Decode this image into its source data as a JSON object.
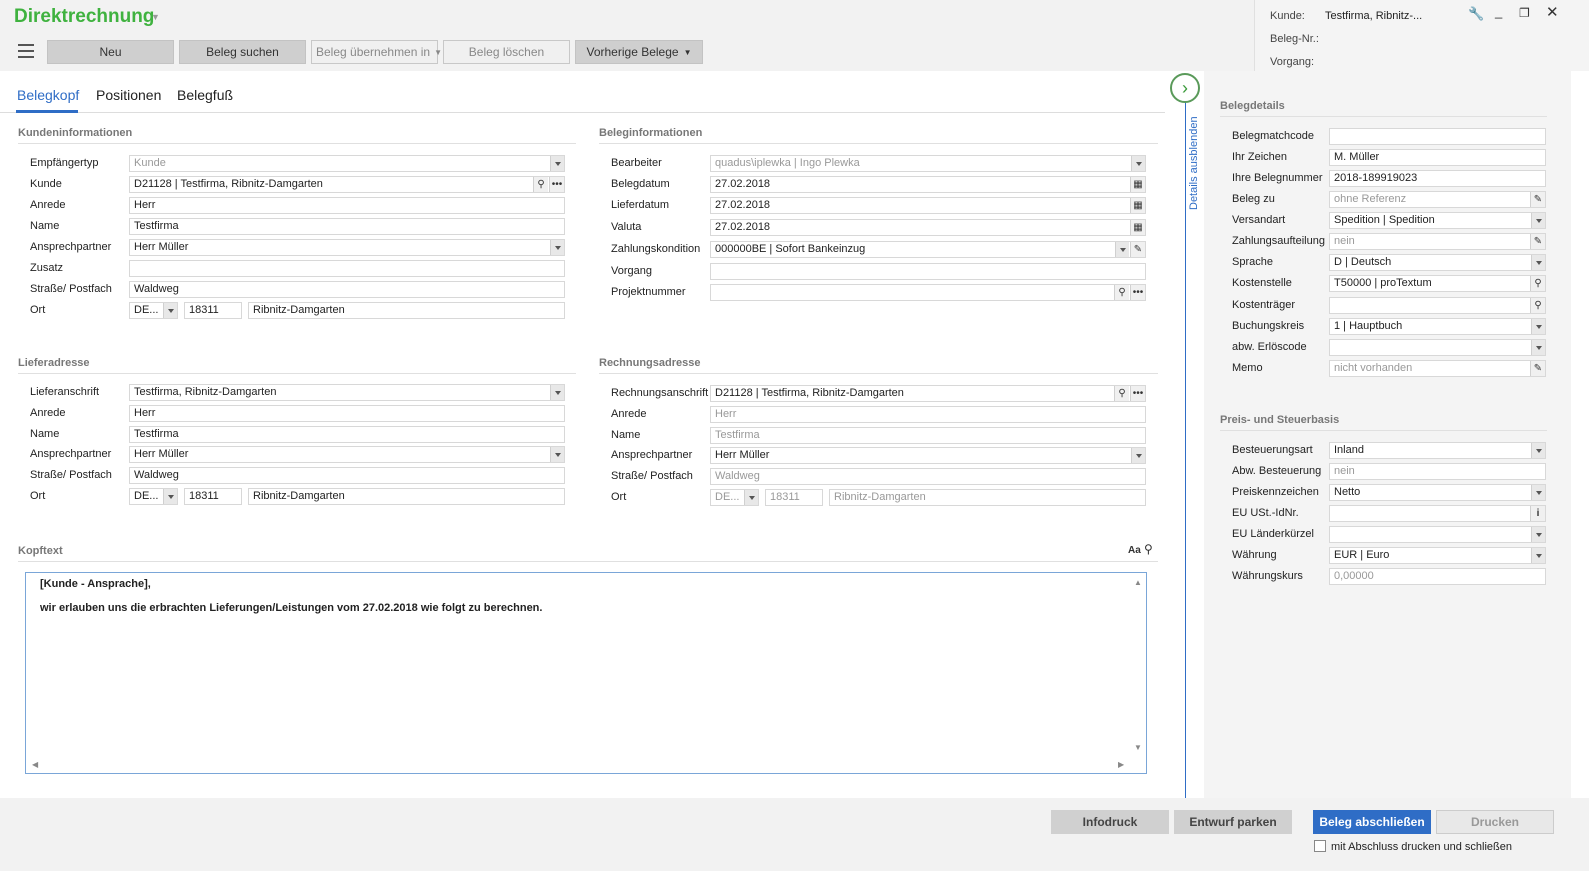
{
  "app": {
    "title": "Direktrechnung"
  },
  "toolbar": {
    "neu": "Neu",
    "beleg_suchen": "Beleg suchen",
    "beleg_uebernehmen": "Beleg übernehmen in",
    "beleg_loeschen": "Beleg löschen",
    "vorherige_belege": "Vorherige Belege"
  },
  "header_info": {
    "kunde_label": "Kunde:",
    "kunde_value": "Testfirma, Ribnitz-...",
    "belegnr_label": "Beleg-Nr.:",
    "vorgang_label": "Vorgang:"
  },
  "tabs": [
    "Belegkopf",
    "Positionen",
    "Belegfuß"
  ],
  "sections": {
    "kunden": "Kundeninformationen",
    "beleg": "Beleginformationen",
    "liefer": "Lieferadresse",
    "rechnung": "Rechnungsadresse",
    "kopf": "Kopftext",
    "details": "Belegdetails",
    "preis": "Preis- und Steuerbasis"
  },
  "kunden": [
    {
      "label": "Empfängertyp",
      "value": "Kunde"
    },
    {
      "label": "Kunde",
      "value": "D21128  |  Testfirma, Ribnitz-Damgarten"
    },
    {
      "label": "Anrede",
      "value": "Herr"
    },
    {
      "label": "Name",
      "value": "Testfirma"
    },
    {
      "label": "Ansprechpartner",
      "value": "Herr Müller"
    },
    {
      "label": "Zusatz",
      "value": ""
    },
    {
      "label": "Straße/ Postfach",
      "value": "Waldweg"
    },
    {
      "label": "Ort",
      "country": "DE...",
      "zip": "18311",
      "city": "Ribnitz-Damgarten"
    }
  ],
  "beleg": [
    {
      "label": "Bearbeiter",
      "value": "quadus\\iplewka  |  Ingo Plewka"
    },
    {
      "label": "Belegdatum",
      "value": "27.02.2018"
    },
    {
      "label": "Lieferdatum",
      "value": "27.02.2018"
    },
    {
      "label": "Valuta",
      "value": "27.02.2018"
    },
    {
      "label": "Zahlungskondition",
      "value": "000000BE  |  Sofort Bankeinzug"
    },
    {
      "label": "Vorgang",
      "value": ""
    },
    {
      "label": "Projektnummer",
      "value": ""
    }
  ],
  "liefer": [
    {
      "label": "Lieferanschrift",
      "value": "Testfirma, Ribnitz-Damgarten"
    },
    {
      "label": "Anrede",
      "value": "Herr"
    },
    {
      "label": "Name",
      "value": "Testfirma"
    },
    {
      "label": "Ansprechpartner",
      "value": "Herr Müller"
    },
    {
      "label": "Straße/ Postfach",
      "value": "Waldweg"
    },
    {
      "label": "Ort",
      "country": "DE...",
      "zip": "18311",
      "city": "Ribnitz-Damgarten"
    }
  ],
  "rechnung": [
    {
      "label": "Rechnungsanschrift",
      "value": "D21128  |  Testfirma, Ribnitz-Damgarten"
    },
    {
      "label": "Anrede",
      "value": "Herr"
    },
    {
      "label": "Name",
      "value": "Testfirma"
    },
    {
      "label": "Ansprechpartner",
      "value": "Herr Müller"
    },
    {
      "label": "Straße/ Postfach",
      "value": "Waldweg"
    },
    {
      "label": "Ort",
      "country": "DE...",
      "zip": "18311",
      "city": "Ribnitz-Damgarten"
    }
  ],
  "kopftext": {
    "line1": "[Kunde - Ansprache],",
    "line2": "wir erlauben uns die erbrachten Lieferungen/Leistungen vom 27.02.2018 wie folgt zu berechnen.",
    "font_btn": "Aa"
  },
  "details_toggle": "Details ausblenden",
  "belegdetails": [
    {
      "label": "Belegmatchcode",
      "value": ""
    },
    {
      "label": "Ihr Zeichen",
      "value": "M. Müller"
    },
    {
      "label": "Ihre Belegnummer",
      "value": "2018-189919023"
    },
    {
      "label": "Beleg zu",
      "value": "ohne Referenz"
    },
    {
      "label": "Versandart",
      "value": "Spedition  |  Spedition"
    },
    {
      "label": "Zahlungsaufteilung",
      "value": "nein"
    },
    {
      "label": "Sprache",
      "value": "D  |  Deutsch"
    },
    {
      "label": "Kostenstelle",
      "value": "T50000  |  proTextum"
    },
    {
      "label": "Kostenträger",
      "value": ""
    },
    {
      "label": "Buchungskreis",
      "value": "1  |  Hauptbuch"
    },
    {
      "label": "abw. Erlöscode",
      "value": ""
    },
    {
      "label": "Memo",
      "value": "nicht vorhanden"
    }
  ],
  "preis": [
    {
      "label": "Besteuerungsart",
      "value": "Inland"
    },
    {
      "label": "Abw. Besteuerung",
      "value": "nein"
    },
    {
      "label": "Preiskennzeichen",
      "value": "Netto"
    },
    {
      "label": "EU USt.-IdNr.",
      "value": ""
    },
    {
      "label": "EU Länderkürzel",
      "value": ""
    },
    {
      "label": "Währung",
      "value": "EUR  |  Euro"
    },
    {
      "label": "Währungskurs",
      "value": "0,00000"
    }
  ],
  "bottom": {
    "infodruck": "Infodruck",
    "entwurf": "Entwurf parken",
    "abschliessen": "Beleg abschließen",
    "drucken": "Drucken",
    "checkbox": "mit Abschluss drucken und schließen"
  }
}
